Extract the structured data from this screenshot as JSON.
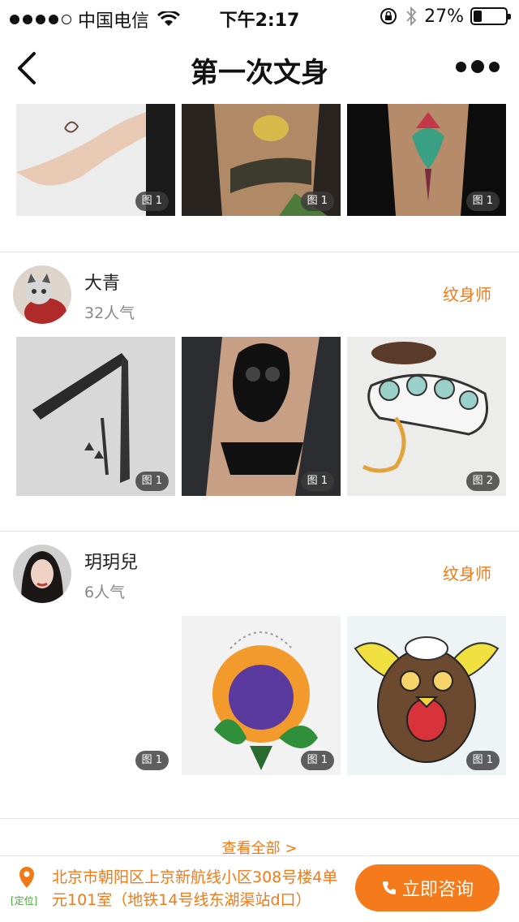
{
  "status_bar": {
    "carrier": "中国电信",
    "time": "下午2:17",
    "battery": "27%",
    "battery_level": 0.27,
    "signal_dots_filled": 4,
    "signal_dots_total": 5
  },
  "nav": {
    "title": "第一次文身"
  },
  "top_row": {
    "badges": [
      "图 1",
      "图 1",
      "图 1"
    ]
  },
  "artists": [
    {
      "name": "大青",
      "popularity": "32人气",
      "role": "纹身师",
      "badges": [
        "图 1",
        "图 1",
        "图 2"
      ]
    },
    {
      "name": "玥玥兒",
      "popularity": "6人气",
      "role": "纹身师",
      "badges": [
        "图 1",
        "图 1",
        "图 1"
      ]
    }
  ],
  "view_all": "查看全部 >",
  "bottom": {
    "location_tag": "[定位]",
    "address": "北京市朝阳区上京新航线小区308号楼4单元101室（地铁14号线东湖渠站d口）",
    "consult_label": "立即咨询"
  },
  "colors": {
    "accent": "#f07a16",
    "button": "#f47a1c",
    "location_tag": "#46a83d",
    "divider": "#e3e3e3"
  }
}
